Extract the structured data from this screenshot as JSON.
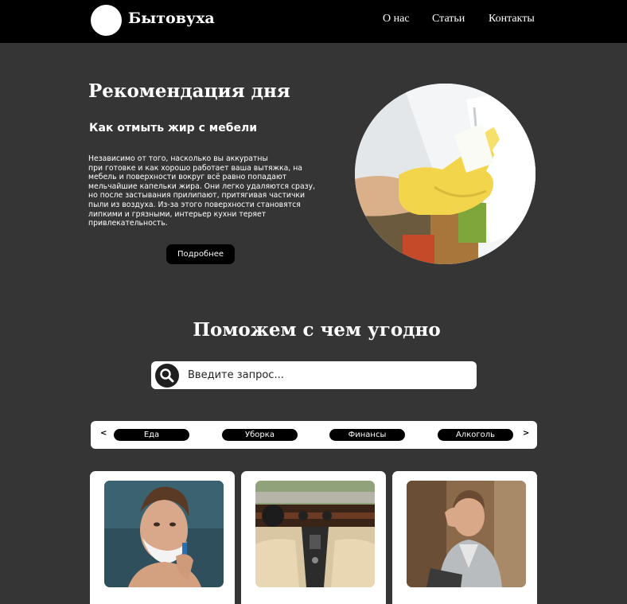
{
  "header": {
    "brand": "Бытовуха",
    "nav": [
      {
        "label": "О нас"
      },
      {
        "label": "Статьи"
      },
      {
        "label": "Контакты"
      }
    ]
  },
  "hero": {
    "title": "Рекомендация дня",
    "subtitle": "Как отмыть жир с мебели",
    "text_lines": [
      "Независимо от того, насколько вы аккуратны",
      "при готовке и как хорошо работает ваша вытяжка, на",
      "мебель и поверхности вокруг всё равно попадают",
      "мельчайшие капельки жира. Они легко удаляются сразу,",
      "но после застывания прилипают, притягивая частички",
      "пыли из воздуха. Из-за этого поверхности становятся",
      "липкими и грязными, интерьер кухни теряет",
      "привлекательность."
    ],
    "button_label": "Подробнее"
  },
  "section": {
    "title": "Поможем с чем угодно"
  },
  "search": {
    "placeholder": "Введите запрос..."
  },
  "categories": {
    "prev": "<",
    "next": ">",
    "items": [
      "Еда",
      "Уборка",
      "Финансы",
      "Алкоголь"
    ]
  },
  "cards": [
    {
      "image": "man-shaving-photo"
    },
    {
      "image": "car-interior-photo"
    },
    {
      "image": "stressed-man-photo"
    }
  ],
  "colors": {
    "background": "#353535",
    "header": "#000000",
    "accent_yellow": "#f2d54b"
  }
}
